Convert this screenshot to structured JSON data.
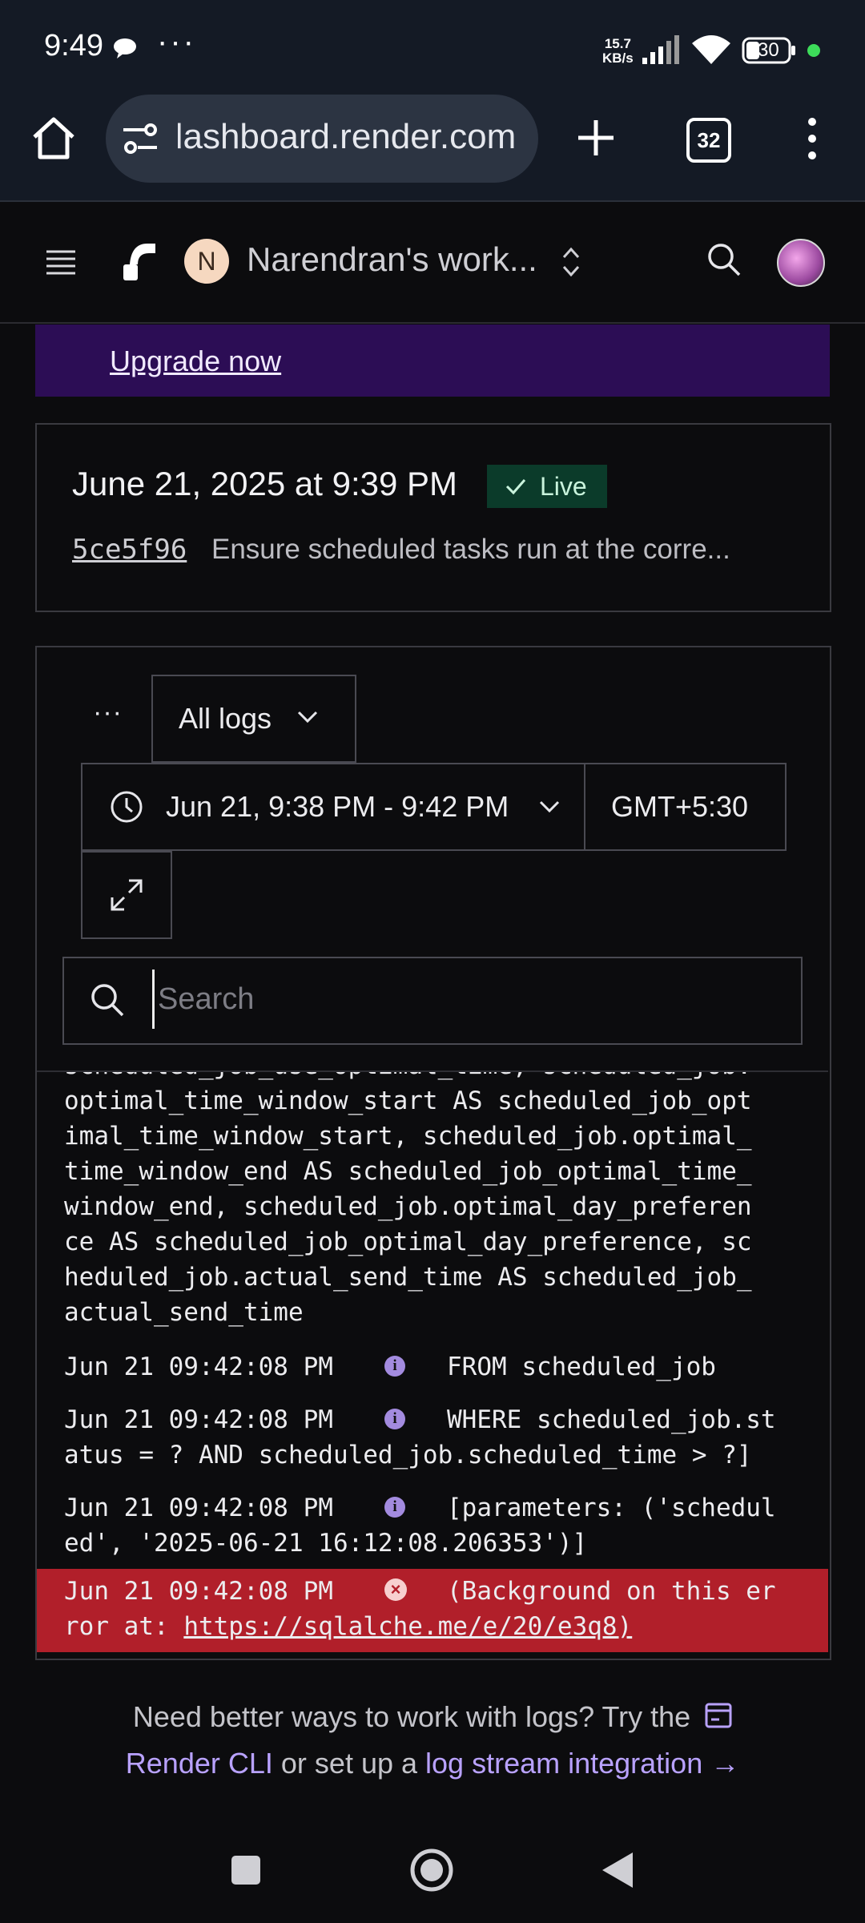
{
  "status_bar": {
    "time": "9:49",
    "more": "···",
    "net_speed_value": "15.7",
    "net_speed_unit": "KB/s",
    "battery": "30"
  },
  "browser": {
    "url": "dashboard.render.com",
    "tab_count": "32"
  },
  "header": {
    "workspace_initial": "N",
    "workspace_name": "Narendran's work..."
  },
  "banner": {
    "upgrade_link": "Upgrade now"
  },
  "deploy": {
    "date": "June 21, 2025 at 9:39 PM",
    "status": "Live",
    "commit_hash": "5ce5f96",
    "commit_message": "Ensure scheduled tasks run at the corre..."
  },
  "logs": {
    "more": "···",
    "filter": "All logs",
    "time_range": "Jun 21, 9:38 PM - 9:42 PM",
    "timezone": "GMT+5:30",
    "search_placeholder": "Search",
    "continued_lines": [
      "scheduled_job_use_optimal_time, scheduled_job.",
      "optimal_time_window_start AS scheduled_job_opt",
      "imal_time_window_start, scheduled_job.optimal_",
      "time_window_end AS scheduled_job_optimal_time_",
      "window_end, scheduled_job.optimal_day_preferen",
      "ce AS scheduled_job_optimal_day_preference, sc",
      "heduled_job.actual_send_time AS scheduled_job_",
      "actual_send_time"
    ],
    "entries": [
      {
        "timestamp": "Jun 21 09:42:08 PM",
        "level": "info",
        "line1": "FROM scheduled_job",
        "line2": ""
      },
      {
        "timestamp": "Jun 21 09:42:08 PM",
        "level": "info",
        "line1": "WHERE scheduled_job.st",
        "line2": "atus = ? AND scheduled_job.scheduled_time > ?]"
      },
      {
        "timestamp": "Jun 21 09:42:08 PM",
        "level": "info",
        "line1": "[parameters: ('schedul",
        "line2": "ed', '2025-06-21 16:12:08.206353')]"
      }
    ],
    "error_entry": {
      "timestamp": "Jun 21 09:42:08 PM",
      "level": "error",
      "line1": "(Background on this er",
      "line2_prefix": "ror at: ",
      "link": "https://sqlalche.me/e/20/e3q8",
      "line2_suffix": ")"
    }
  },
  "footer": {
    "text_1": "Need better ways to work with logs? Try the",
    "link_cli": "Render CLI",
    "text_2": "or set up a",
    "link_stream": "log stream integration →"
  },
  "colors": {
    "upgrade_bg": "#2c0d55",
    "live_bg": "#0b3b2a",
    "error_row_bg": "#b11f2a",
    "accent": "#b9a2ff",
    "battery_dot": "#3ddc5a"
  }
}
